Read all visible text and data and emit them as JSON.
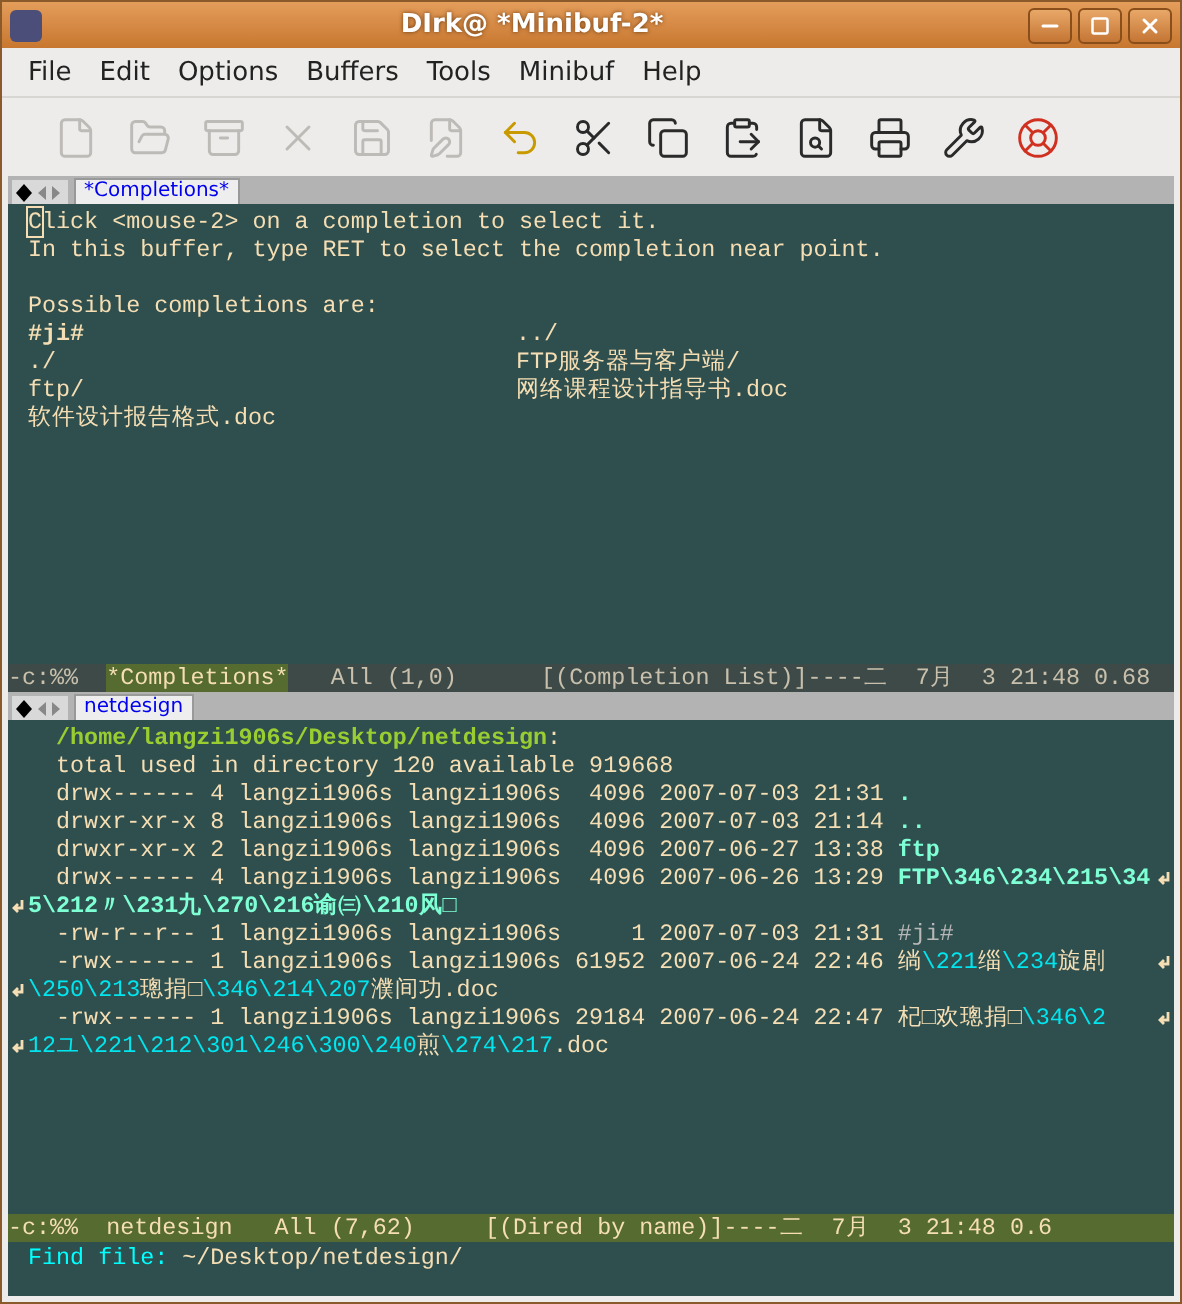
{
  "window": {
    "title": "DIrk@ *Minibuf-2*"
  },
  "menu": [
    "File",
    "Edit",
    "Options",
    "Buffers",
    "Tools",
    "Minibuf",
    "Help"
  ],
  "toolbar": [
    {
      "kind": "new",
      "disabled": true
    },
    {
      "kind": "open",
      "disabled": true
    },
    {
      "kind": "cabinet",
      "disabled": true
    },
    {
      "kind": "close",
      "disabled": true
    },
    {
      "kind": "save",
      "disabled": true
    },
    {
      "kind": "saveas",
      "disabled": true
    },
    {
      "kind": "undo",
      "disabled": false
    },
    {
      "kind": "cut",
      "disabled": false
    },
    {
      "kind": "copy",
      "disabled": false
    },
    {
      "kind": "paste",
      "disabled": false
    },
    {
      "kind": "search",
      "disabled": false
    },
    {
      "kind": "print",
      "disabled": false
    },
    {
      "kind": "tools",
      "disabled": false
    },
    {
      "kind": "help",
      "disabled": false
    }
  ],
  "completions": {
    "tab": "*Completions*",
    "cursor_on_first_char": true,
    "intro": [
      "Click <mouse-2> on a completion to select it.",
      "In this buffer, type RET to select the completion near point."
    ],
    "heading": "Possible completions are:",
    "items": [
      {
        "text": "#ji#",
        "kind": "backup"
      },
      {
        "text": "../",
        "kind": "plain"
      },
      {
        "text": "./",
        "kind": "plain"
      },
      {
        "text": "FTP服务器与客户端/",
        "kind": "plain"
      },
      {
        "text": "ftp/",
        "kind": "plain"
      },
      {
        "text": "网络课程设计指导书.doc",
        "kind": "plain"
      },
      {
        "text": "软件设计报告格式.doc",
        "kind": "plain"
      }
    ],
    "mode_line": {
      "active": false,
      "prefix": "-c:%%",
      "buffer": "*Completions*",
      "rest": "All (1,0)      [(Completion List)]----二  7月  3 21:48 0.68"
    }
  },
  "dired": {
    "tab": "netdesign",
    "lines": [
      {
        "continued": false,
        "continues": false,
        "segments": [
          {
            "text": "/home/langzi1906s/Desktop/netdesign",
            "kind": "header"
          },
          {
            "text": ":",
            "kind": "plain"
          }
        ]
      },
      {
        "continued": false,
        "continues": false,
        "segments": [
          {
            "text": "total used in directory 120 available 919668",
            "kind": "plain"
          }
        ]
      },
      {
        "continued": false,
        "continues": false,
        "segments": [
          {
            "text": "drwx------ 4 langzi1906s langzi1906s  4096 2007-07-03 21:31 ",
            "kind": "plain"
          },
          {
            "text": ".",
            "kind": "dir"
          }
        ]
      },
      {
        "continued": false,
        "continues": false,
        "segments": [
          {
            "text": "drwxr-xr-x 8 langzi1906s langzi1906s  4096 2007-07-03 21:14 ",
            "kind": "plain"
          },
          {
            "text": "..",
            "kind": "dir"
          }
        ]
      },
      {
        "continued": false,
        "continues": false,
        "segments": [
          {
            "text": "drwxr-xr-x 2 langzi1906s langzi1906s  4096 2007-06-27 13:38 ",
            "kind": "plain"
          },
          {
            "text": "ftp",
            "kind": "dir"
          }
        ]
      },
      {
        "continued": false,
        "continues": true,
        "segments": [
          {
            "text": "drwx------ 4 langzi1906s langzi1906s  4096 2007-06-26 13:29 ",
            "kind": "plain"
          },
          {
            "text": "FTP\\346\\234\\215\\34",
            "kind": "dir"
          }
        ]
      },
      {
        "continued": true,
        "continues": false,
        "segments": [
          {
            "text": "5\\212〃\\231九\\270\\216谕㈢\\210风□",
            "kind": "dir"
          }
        ]
      },
      {
        "continued": false,
        "continues": false,
        "segments": [
          {
            "text": "-rw-r--r-- 1 langzi1906s langzi1906s     1 2007-07-03 21:31 ",
            "kind": "plain"
          },
          {
            "text": "#ji#",
            "kind": "backup"
          }
        ]
      },
      {
        "continued": false,
        "continues": true,
        "segments": [
          {
            "text": "-rwx------ 1 langzi1906s langzi1906s 61952 2007-06-24 22:46 ",
            "kind": "plain"
          },
          {
            "text": "绱",
            "kind": "plain"
          },
          {
            "text": "\\221",
            "kind": "esc"
          },
          {
            "text": "缁",
            "kind": "plain"
          },
          {
            "text": "\\234",
            "kind": "esc"
          },
          {
            "text": "旋剧",
            "kind": "plain"
          }
        ]
      },
      {
        "continued": true,
        "continues": false,
        "segments": [
          {
            "text": "\\250\\213",
            "kind": "esc"
          },
          {
            "text": "璁捐□",
            "kind": "plain"
          },
          {
            "text": "\\346\\214\\207",
            "kind": "esc"
          },
          {
            "text": "濮间功.doc",
            "kind": "plain"
          }
        ]
      },
      {
        "continued": false,
        "continues": true,
        "segments": [
          {
            "text": "-rwx------ 1 langzi1906s langzi1906s 29184 2007-06-24 22:47 ",
            "kind": "plain"
          },
          {
            "text": "杞□欢璁捐□",
            "kind": "plain"
          },
          {
            "text": "\\346\\2",
            "kind": "esc"
          }
        ]
      },
      {
        "continued": true,
        "continues": false,
        "segments": [
          {
            "text": "12ユ\\221\\212\\301\\246\\300\\240",
            "kind": "esc"
          },
          {
            "text": "煎",
            "kind": "plain"
          },
          {
            "text": "\\274\\217",
            "kind": "esc"
          },
          {
            "text": ".doc",
            "kind": "plain"
          }
        ]
      }
    ],
    "mode_line": {
      "active": true,
      "prefix": "-c:%%",
      "buffer": "netdesign",
      "rest": "All (7,62)     [(Dired by name)]----二  7月  3 21:48 0.6"
    }
  },
  "minibuffer": {
    "prompt": "Find file:",
    "value": "~/Desktop/netdesign/"
  }
}
